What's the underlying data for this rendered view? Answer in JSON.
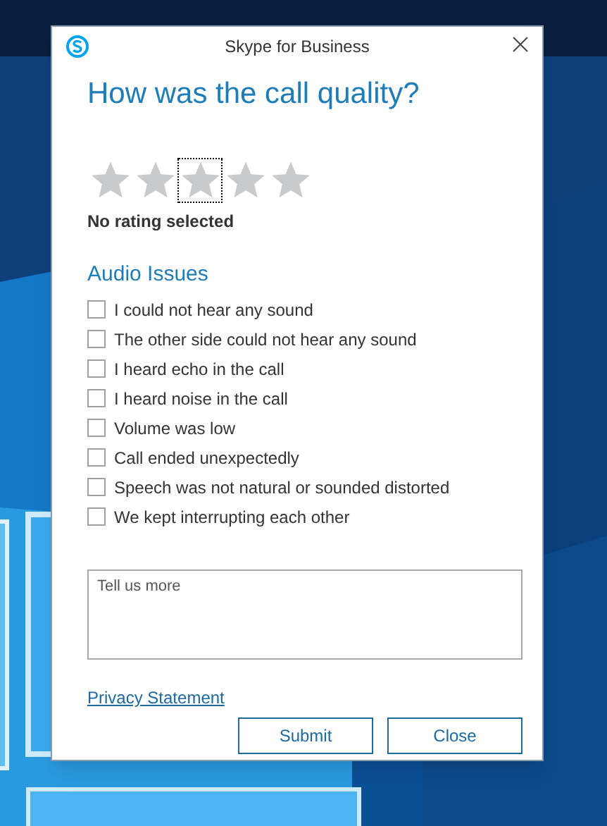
{
  "window": {
    "title": "Skype for Business"
  },
  "heading": "How was the call quality?",
  "rating": {
    "stars": 0,
    "star_slots": [
      {
        "focused": false
      },
      {
        "focused": false
      },
      {
        "focused": true
      },
      {
        "focused": false
      },
      {
        "focused": false
      }
    ],
    "caption": "No rating selected"
  },
  "section_title": "Audio Issues",
  "issues": [
    {
      "label": "I could not hear any sound",
      "checked": false
    },
    {
      "label": "The other side could not hear any sound",
      "checked": false
    },
    {
      "label": "I heard echo in the call",
      "checked": false
    },
    {
      "label": "I heard noise in the call",
      "checked": false
    },
    {
      "label": "Volume was low",
      "checked": false
    },
    {
      "label": "Call ended unexpectedly",
      "checked": false
    },
    {
      "label": "Speech was not natural or sounded distorted",
      "checked": false
    },
    {
      "label": "We kept interrupting each other",
      "checked": false
    }
  ],
  "comment": {
    "placeholder": "Tell us more"
  },
  "privacy_link": "Privacy Statement",
  "buttons": [
    "Submit",
    "Close"
  ]
}
